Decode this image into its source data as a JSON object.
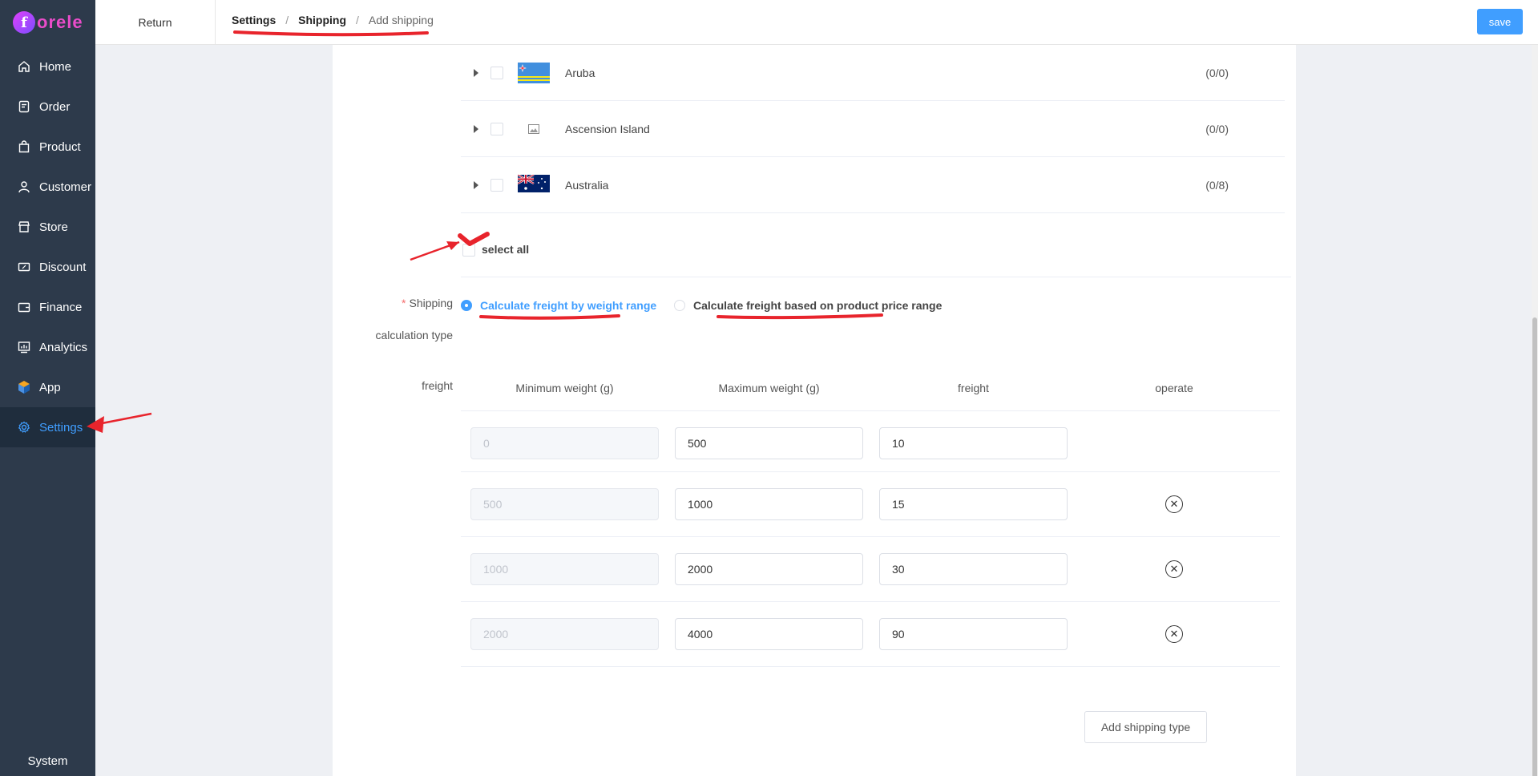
{
  "app": {
    "logo_letter": "f",
    "logo_text": "orele"
  },
  "sidebar": {
    "items": [
      {
        "label": "Home",
        "icon": "home-icon"
      },
      {
        "label": "Order",
        "icon": "order-icon"
      },
      {
        "label": "Product",
        "icon": "product-bag-icon"
      },
      {
        "label": "Customer",
        "icon": "customer-user-icon"
      },
      {
        "label": "Store",
        "icon": "store-icon"
      },
      {
        "label": "Discount",
        "icon": "discount-ticket-icon"
      },
      {
        "label": "Finance",
        "icon": "finance-wallet-icon"
      },
      {
        "label": "Analytics",
        "icon": "analytics-chart-icon"
      },
      {
        "label": "App",
        "icon": "app-cube-icon"
      },
      {
        "label": "Settings",
        "icon": "settings-gear-icon",
        "active": true
      }
    ],
    "system_label": "System"
  },
  "header": {
    "return_label": "Return",
    "breadcrumb": [
      "Settings",
      "Shipping",
      "Add shipping"
    ],
    "save_label": "save"
  },
  "countries": [
    {
      "name": "Aruba",
      "count": "(0/0)",
      "flag": "aruba-flag"
    },
    {
      "name": "Ascension Island",
      "count": "(0/0)",
      "flag": "image-placeholder-icon"
    },
    {
      "name": "Australia",
      "count": "(0/8)",
      "flag": "australia-flag"
    }
  ],
  "select_all_label": "select all",
  "shipping_calc": {
    "label_line1": "Shipping",
    "label_line2": "calculation type",
    "required_mark": "*",
    "options": [
      {
        "label": "Calculate freight by weight range",
        "selected": true
      },
      {
        "label": "Calculate freight based on product price range",
        "selected": false
      }
    ]
  },
  "freight": {
    "label": "freight",
    "columns": [
      "Minimum weight (g)",
      "Maximum weight (g)",
      "freight",
      "operate"
    ],
    "rows": [
      {
        "min": "0",
        "max": "500",
        "freight": "10",
        "deletable": false
      },
      {
        "min": "500",
        "max": "1000",
        "freight": "15",
        "deletable": true
      },
      {
        "min": "1000",
        "max": "2000",
        "freight": "30",
        "deletable": true
      },
      {
        "min": "2000",
        "max": "4000",
        "freight": "90",
        "deletable": true
      }
    ]
  },
  "add_shipping_type_label": "Add shipping type",
  "colors": {
    "accent": "#409eff",
    "sidebar_bg": "#2d3a4b",
    "annotation_red": "#e8242c"
  }
}
